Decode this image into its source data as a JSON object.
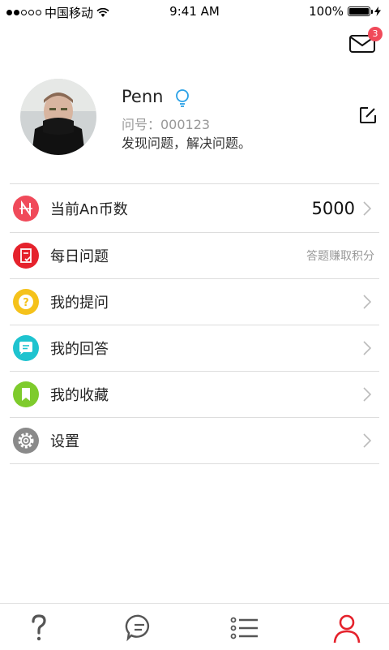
{
  "status_bar": {
    "carrier": "中国移动",
    "time": "9:41 AM",
    "battery": "100%",
    "battery_level": 1.0
  },
  "header": {
    "mail_icon": "mail-icon",
    "unread_count": "3",
    "badge_color": "#f04a5a"
  },
  "profile": {
    "name": "Penn",
    "id_line": "问号：000123",
    "signature": "发现问题，解决问题。",
    "bulb_color": "#2aa1e6"
  },
  "menu": {
    "coins": {
      "label": "当前An币数",
      "value": "5000",
      "icon_color": "#f04a5a"
    },
    "daily": {
      "label": "每日问题",
      "hint": "答题赚取积分",
      "icon_color": "#e5222c"
    },
    "my_questions": {
      "label": "我的提问",
      "icon_color": "#f5c21b"
    },
    "my_answers": {
      "label": "我的回答",
      "icon_color": "#1ec3cf"
    },
    "my_favorites": {
      "label": "我的收藏",
      "icon_color": "#7ecb2c"
    },
    "settings": {
      "label": "设置",
      "icon_color": "#8a8a8a"
    }
  },
  "tab_bar": {
    "tabs": [
      "question-tab",
      "chat-tab",
      "list-tab",
      "profile-tab"
    ],
    "active": "profile-tab",
    "active_color": "#e5222c",
    "inactive_color": "#555555"
  }
}
